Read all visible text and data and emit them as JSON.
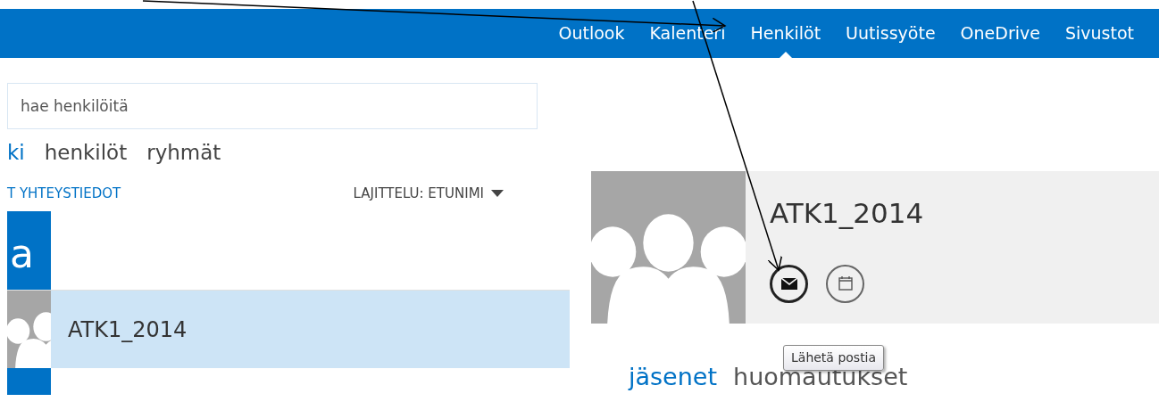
{
  "nav": {
    "items": [
      {
        "label": "Outlook",
        "selected": false
      },
      {
        "label": "Kalenteri",
        "selected": false
      },
      {
        "label": "Henkilöt",
        "selected": true
      },
      {
        "label": "Uutissyöte",
        "selected": false
      },
      {
        "label": "OneDrive",
        "selected": false
      },
      {
        "label": "Sivustot",
        "selected": false
      }
    ]
  },
  "search": {
    "placeholder": "hae henkilöitä"
  },
  "view_tabs": [
    {
      "label": "ki",
      "selected": true
    },
    {
      "label": "henkilöt",
      "selected": false
    },
    {
      "label": "ryhmät",
      "selected": false
    }
  ],
  "list_header": {
    "filter": "T YHTEYSTIEDOT",
    "sort": "LAJITTELU: ETUNIMI"
  },
  "contact_list": [
    {
      "kind": "letter",
      "label": "a"
    },
    {
      "kind": "group",
      "name": "ATK1_2014",
      "selected": true
    },
    {
      "kind": "letter-cut"
    }
  ],
  "detail": {
    "name": "ATK1_2014",
    "tooltip": "Lähetä postia",
    "tabs": [
      {
        "label": "jäsenet",
        "selected": true
      },
      {
        "label": "huomautukset",
        "selected": false
      }
    ]
  }
}
